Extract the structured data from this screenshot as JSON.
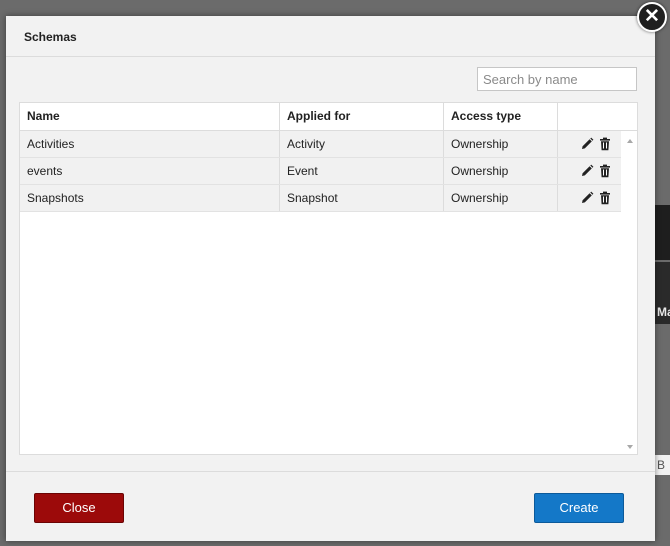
{
  "dialog": {
    "title": "Schemas",
    "search_placeholder": "Search by name",
    "columns": [
      "Name",
      "Applied for",
      "Access type"
    ],
    "rows": [
      {
        "name": "Activities",
        "applied_for": "Activity",
        "access_type": "Ownership"
      },
      {
        "name": "events",
        "applied_for": "Event",
        "access_type": "Ownership"
      },
      {
        "name": "Snapshots",
        "applied_for": "Snapshot",
        "access_type": "Ownership"
      }
    ],
    "close_label": "Close",
    "create_label": "Create",
    "close_icon": "close-x-icon",
    "row_icons": [
      "edit-icon",
      "delete-icon"
    ]
  },
  "background": {
    "peek_text": "Ma",
    "peek_text_2": "B"
  },
  "colors": {
    "close_button": "#9c0a0a",
    "create_button": "#1478c8",
    "row_background": "#f1f1f1"
  }
}
